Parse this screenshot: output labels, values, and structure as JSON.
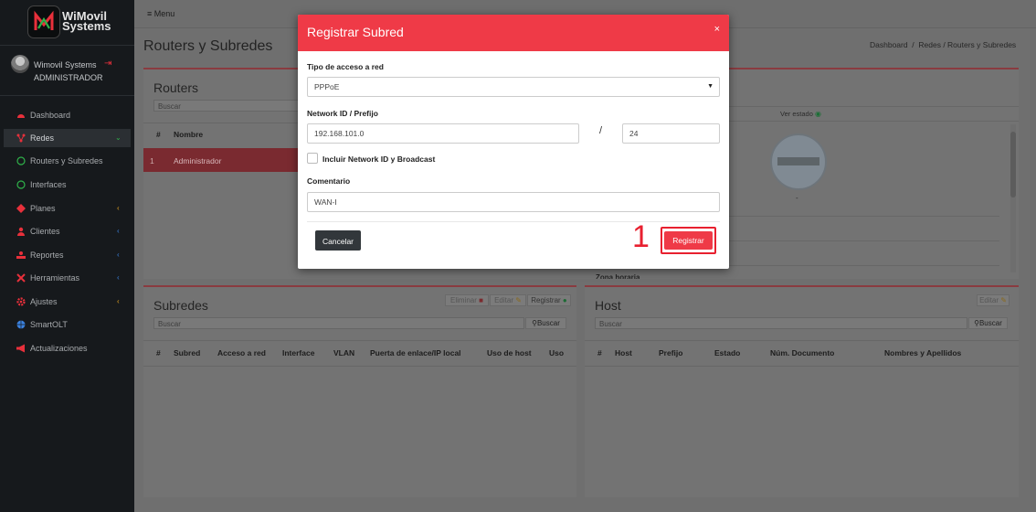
{
  "sidebar": {
    "logo_line1": "WiMovil",
    "logo_line2": "Systems",
    "user_name": "Wimovil Systems",
    "user_role": "ADMINISTRADOR",
    "items": [
      {
        "label": "Dashboard",
        "icon": "dashboard-icon"
      },
      {
        "label": "Redes",
        "icon": "network-icon",
        "chevron": "⌄"
      },
      {
        "label": "Routers y Subredes",
        "icon": "circle-icon"
      },
      {
        "label": "Interfaces",
        "icon": "circle-icon"
      },
      {
        "label": "Planes",
        "icon": "plans-icon",
        "chevron": "‹"
      },
      {
        "label": "Clientes",
        "icon": "users-icon",
        "chevron": "‹"
      },
      {
        "label": "Reportes",
        "icon": "reports-icon",
        "chevron": "‹"
      },
      {
        "label": "Herramientas",
        "icon": "tools-icon",
        "chevron": "‹"
      },
      {
        "label": "Ajustes",
        "icon": "gear-icon",
        "chevron": "‹"
      },
      {
        "label": "SmartOLT",
        "icon": "globe-icon"
      },
      {
        "label": "Actualizaciones",
        "icon": "megaphone-icon"
      }
    ]
  },
  "topbar": {
    "menu_label": "≡ Menu"
  },
  "page": {
    "title": "Routers y Subredes",
    "breadcrumb": "Dashboard  /  Redes / Routers y Subredes"
  },
  "routers_card": {
    "title": "Routers",
    "search_placeholder": "Buscar",
    "col_num": "#",
    "col_name": "Nombre",
    "row_num": "1",
    "row_name": "Administrador"
  },
  "status_card": {
    "ver_estado": "Ver estado",
    "dash": "-",
    "zona": "Zona horaria"
  },
  "subredes_card": {
    "title": "Subredes",
    "btn_eliminar": "Eliminar",
    "btn_editar": "Editar",
    "btn_registrar": "Registrar",
    "search_placeholder": "Buscar",
    "search_btn": "Buscar",
    "columns": [
      "#",
      "Subred",
      "Acceso a red",
      "Interface",
      "VLAN",
      "Puerta de enlace/IP local",
      "Uso de host",
      "Uso"
    ]
  },
  "host_card": {
    "title": "Host",
    "btn_editar": "Editar",
    "search_placeholder": "Buscar",
    "search_btn": "Buscar",
    "columns": [
      "#",
      "Host",
      "Prefijo",
      "Estado",
      "Núm. Documento",
      "Nombres y Apellidos"
    ]
  },
  "modal": {
    "title": "Registrar Subred",
    "close": "×",
    "tipo_label": "Tipo de acceso a red",
    "tipo_value": "PPPoE",
    "network_label": "Network ID / Prefijo",
    "network_value": "192.168.101.0",
    "slash": "/",
    "prefix_value": "24",
    "checkbox_label": "Incluir Network ID y Broadcast",
    "comentario_label": "Comentario",
    "comentario_value": "WAN-I",
    "btn_cancel": "Cancelar",
    "btn_register": "Registrar",
    "step": "1"
  },
  "colors": {
    "accent": "#ef3a47",
    "sidebar_bg": "#16191c",
    "highlight": "#e8202f"
  }
}
